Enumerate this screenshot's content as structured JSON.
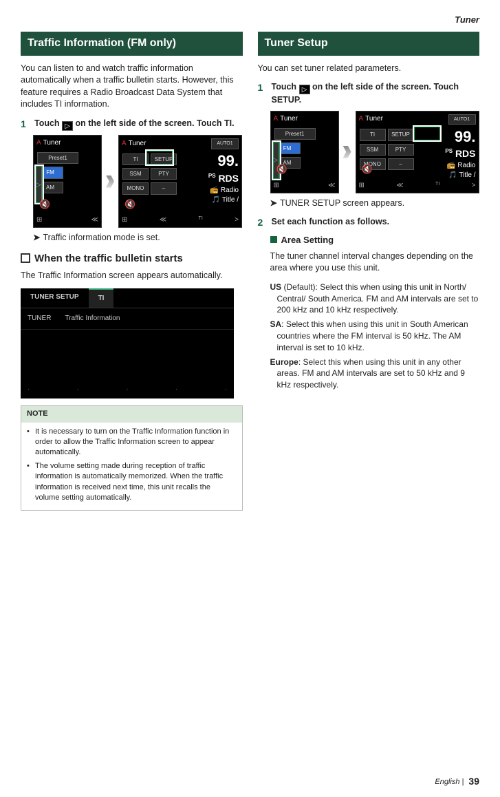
{
  "page_header": "Tuner",
  "left": {
    "section_title": "Traffic Information  (FM only)",
    "intro": "You can listen to and watch traffic information automatically when a traffic bulletin starts. However, this feature requires a Radio Broadcast Data System that includes TI information.",
    "step1_a": "Touch ",
    "step1_b": " on the left side of the screen. Touch ",
    "step1_c": "TI",
    "step1_d": ".",
    "result": "Traffic information mode is set.",
    "sub_heading": "When the traffic bulletin starts",
    "sub_text": "The Traffic Information screen appears automatically.",
    "ti_screen": {
      "tab1": "TUNER SETUP",
      "tab2": "TI",
      "row_label": "TUNER",
      "row_value": "Traffic Information"
    },
    "note_title": "NOTE",
    "note1": "It is necessary to turn on the Traffic Information function in order to allow the Traffic Information screen to appear automatically.",
    "note2": "The volume setting made during reception of traffic information is automatically memorized. When the traffic information is received next time, this unit recalls the volume setting automatically."
  },
  "right": {
    "section_title": "Tuner Setup",
    "intro": "You can set tuner related parameters.",
    "step1_a": "Touch ",
    "step1_b": " on the left side of the screen. Touch ",
    "step1_c": "SETUP",
    "step1_d": ".",
    "result": "TUNER SETUP screen appears.",
    "step2": "Set each function as follows.",
    "area_title": "Area Setting",
    "area_text": "The tuner channel interval changes depending on the area where you use this unit.",
    "us_name": "US",
    "us_text": " (Default): Select this when using this unit in North/ Central/ South America. FM and AM intervals are set to 200 kHz and 10 kHz respectively.",
    "sa_name": "SA",
    "sa_text": ": Select this when using this unit in South American countries where the FM interval is 50 kHz. The AM interval is set to 10 kHz.",
    "eu_name": "Europe",
    "eu_text": ": Select this when using this unit in any other areas. FM and AM intervals are set to 50 kHz and 9 kHz respectively."
  },
  "mock": {
    "tuner": "Tuner",
    "preset": "Preset1",
    "fm": "FM",
    "am": "AM",
    "ti": "TI",
    "setup": "SETUP",
    "ssm": "SSM",
    "pty": "PTY",
    "mono": "MONO",
    "dash": "–",
    "auto": "AUTO1",
    "freq": "99.",
    "rds": "RDS",
    "radio": "Radio",
    "titleline": "Title /",
    "ps": "PS"
  },
  "footer": {
    "lang": "English",
    "page": "39"
  }
}
